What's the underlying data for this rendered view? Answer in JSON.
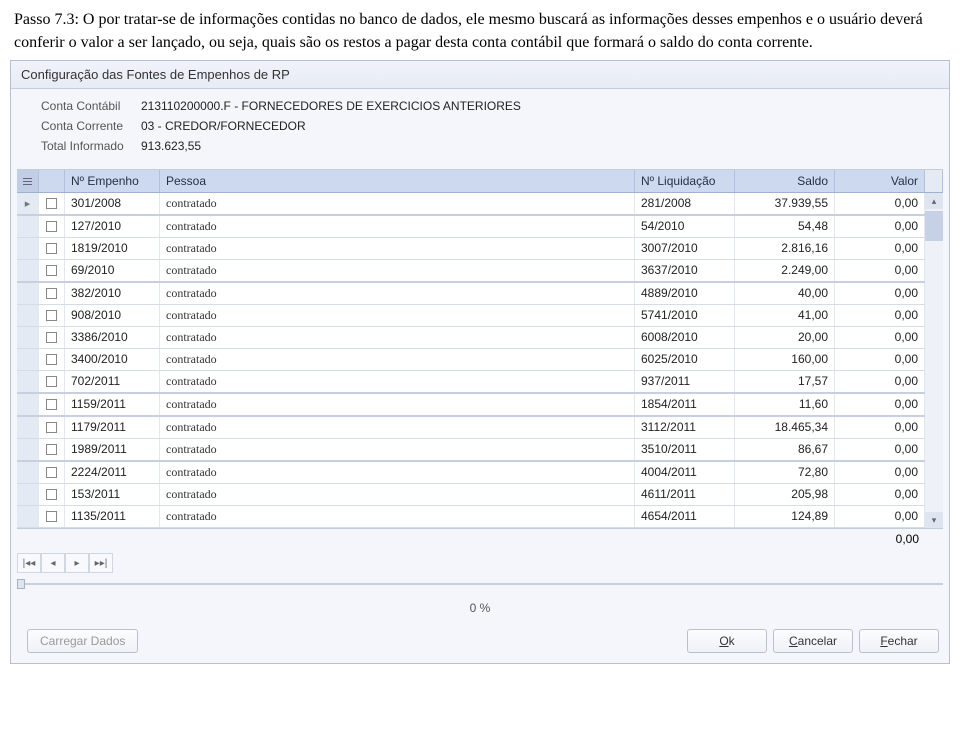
{
  "intro_text": "Passo 7.3: O por tratar-se de informações contidas no banco de dados, ele mesmo buscará as informações desses empenhos e o usuário deverá conferir o valor a ser lançado, ou seja, quais são os restos a pagar desta conta contábil que formará o saldo do conta corrente.",
  "window_title": "Configuração das Fontes de Empenhos de RP",
  "header": {
    "conta_contabil_label": "Conta Contábil",
    "conta_contabil_value": "213110200000.F - FORNECEDORES DE EXERCICIOS ANTERIORES",
    "conta_corrente_label": "Conta Corrente",
    "conta_corrente_value": "03 - CREDOR/FORNECEDOR",
    "total_informado_label": "Total Informado",
    "total_informado_value": "913.623,55"
  },
  "columns": {
    "empenho": "Nº Empenho",
    "pessoa": "Pessoa",
    "liquidacao": "Nº Liquidação",
    "saldo": "Saldo",
    "valor": "Valor"
  },
  "rows": [
    {
      "emp": "301/2008",
      "pes": "contratado",
      "liq": "281/2008",
      "sal": "37.939,55",
      "val": "0,00",
      "marker": true,
      "sep": true
    },
    {
      "emp": "127/2010",
      "pes": "contratado",
      "liq": "54/2010",
      "sal": "54,48",
      "val": "0,00"
    },
    {
      "emp": "1819/2010",
      "pes": "contratado",
      "liq": "3007/2010",
      "sal": "2.816,16",
      "val": "0,00"
    },
    {
      "emp": "69/2010",
      "pes": "contratado",
      "liq": "3637/2010",
      "sal": "2.249,00",
      "val": "0,00",
      "sep": true
    },
    {
      "emp": "382/2010",
      "pes": "contratado",
      "liq": "4889/2010",
      "sal": "40,00",
      "val": "0,00"
    },
    {
      "emp": "908/2010",
      "pes": "contratado",
      "liq": "5741/2010",
      "sal": "41,00",
      "val": "0,00"
    },
    {
      "emp": "3386/2010",
      "pes": "contratado",
      "liq": "6008/2010",
      "sal": "20,00",
      "val": "0,00"
    },
    {
      "emp": "3400/2010",
      "pes": "contratado",
      "liq": "6025/2010",
      "sal": "160,00",
      "val": "0,00"
    },
    {
      "emp": "702/2011",
      "pes": "contratado",
      "liq": "937/2011",
      "sal": "17,57",
      "val": "0,00",
      "sep": true
    },
    {
      "emp": "1159/2011",
      "pes": "contratado",
      "liq": "1854/2011",
      "sal": "11,60",
      "val": "0,00",
      "sep": true
    },
    {
      "emp": "1179/2011",
      "pes": "contratado",
      "liq": "3112/2011",
      "sal": "18.465,34",
      "val": "0,00"
    },
    {
      "emp": "1989/2011",
      "pes": "contratado",
      "liq": "3510/2011",
      "sal": "86,67",
      "val": "0,00",
      "sep": true
    },
    {
      "emp": "2224/2011",
      "pes": "contratado",
      "liq": "4004/2011",
      "sal": "72,80",
      "val": "0,00"
    },
    {
      "emp": "153/2011",
      "pes": "contratado",
      "liq": "4611/2011",
      "sal": "205,98",
      "val": "0,00"
    },
    {
      "emp": "1135/2011",
      "pes": "contratado",
      "liq": "4654/2011",
      "sal": "124,89",
      "val": "0,00"
    }
  ],
  "footer_valor": "0,00",
  "progress_text": "0 %",
  "buttons": {
    "carregar": "Carregar Dados",
    "ok": "Ok",
    "cancelar": "Cancelar",
    "fechar": "Fechar"
  }
}
